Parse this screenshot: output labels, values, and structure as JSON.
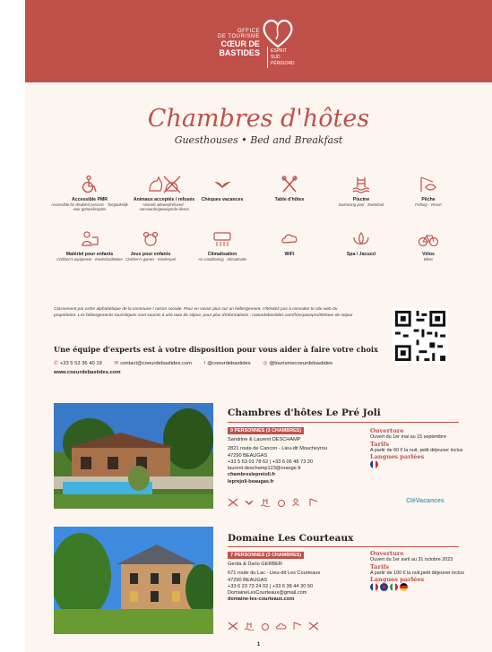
{
  "logo": {
    "line1": "OFFICE",
    "line2": "DE TOURISME",
    "line3": "CŒUR DE",
    "line4": "BASTIDES",
    "side1": "ESPRIT",
    "side2": "SUD",
    "side3": "PÉRIGORD"
  },
  "title": "Chambres d'hôtes",
  "subtitle": "Guesthouses • Bed and Breakfast",
  "amenities": [
    {
      "name": "Accessible PMR",
      "sub": "Accessible for disabled persons · Toegankelijk voor gehandicapten",
      "icon": "wheelchair-icon"
    },
    {
      "name": "Animaux acceptés / refusés",
      "sub": "Animals allowed/refused · Aanvaarde/geweigerde dieren",
      "icon": "pet-icon"
    },
    {
      "name": "Chèques vacances",
      "sub": "",
      "icon": "swallow-icon"
    },
    {
      "name": "Table d'hôtes",
      "sub": "",
      "icon": "cutlery-icon"
    },
    {
      "name": "Piscine",
      "sub": "Swimming pool · Zwembad",
      "icon": "pool-icon"
    },
    {
      "name": "Pêche",
      "sub": "Fishing · Vissen",
      "icon": "fishing-icon"
    },
    {
      "name": "Matériel pour enfants",
      "sub": "Children's equipment · Kinderfaciliteiten",
      "icon": "baby-icon"
    },
    {
      "name": "Jeux pour enfants",
      "sub": "Children's games · Kinderspel",
      "icon": "toy-icon"
    },
    {
      "name": "Climatisation",
      "sub": "Air conditioning · Klimatisatie",
      "icon": "aircon-icon"
    },
    {
      "name": "WiFi",
      "sub": "",
      "icon": "wifi-icon"
    },
    {
      "name": "Spa / Jacuzzi",
      "sub": "",
      "icon": "spa-icon"
    },
    {
      "name": "Vélos",
      "sub": "Bikes",
      "icon": "bike-icon"
    }
  ],
  "info": "Classement par ordre alphabétique de la commune / raison sociale. Pour en savoir plus sur un hébergement, n'hésitez pas à consulter le site web du propriétaire. Les hébergements touristiques sont soumis à une taxe de séjour, pour plus d'informations : coeurdebastides.com/fr/espacepro/80/taxe-de-sejour",
  "experts": "Une équipe d'experts est à votre disposition pour vous aider à faire votre choix",
  "contact": {
    "phone": "+33 5 53 36 40 19",
    "email": "contact@coeurdebastides.com",
    "facebook": "@coeurdebastides",
    "instagram": "@tourismecoeurdebastides",
    "website": "www.coeurdebastides.com"
  },
  "listings": [
    {
      "title": "Chambres d'hôtes Le Pré Joli",
      "capacity": "9 PERSONNES (3 CHAMBRES)",
      "owner": "Sandrine & Laurent DESCHAMP",
      "address1": "2821 route de Cancon - Lieu-dit Moucheyrou",
      "address2": "47290 BEAUGAS",
      "phone": "+33 5 53 01 78 62 | +33 6 06 48 73 20",
      "email": "laurent.deschamp123@orange.fr",
      "web1": "chambreslepreioli.fr",
      "web2": "leprejoli-beaugas.fr",
      "opening_h": "Ouverture",
      "opening": "Ouvert du 1er mai au 15 septembre",
      "rates_h": "Tarifs",
      "rates": "A partir de 60 € la nuit, petit déjeuner inclus",
      "lang_h": "Langues parlées",
      "label": "CléVacances"
    },
    {
      "title": "Domaine Les Courteaux",
      "capacity": "7 PERSONNES (3 CHAMBRES)",
      "owner": "Gerda & Dario GERBER",
      "address1": "671 route du Lac - Lieu-dit Les Courteaux",
      "address2": "47290 BEAUGAS",
      "phone": "+33 6 23 73 24 02 | +33 6 38 44 30 50",
      "email": "DomaineLesCourteaux@gmail.com",
      "web1": "domaine-les-courteaux.com",
      "opening_h": "Ouverture",
      "opening": "Ouvert du 1er avril au 31 octobre 2023",
      "rates_h": "Tarifs",
      "rates": "A partir de 100 € la nuit,petit déjeuner inclus",
      "lang_h": "Langues parlées"
    }
  ],
  "page_number": "1",
  "colors": {
    "brand": "#c0504a",
    "background": "#fdf6f0"
  }
}
